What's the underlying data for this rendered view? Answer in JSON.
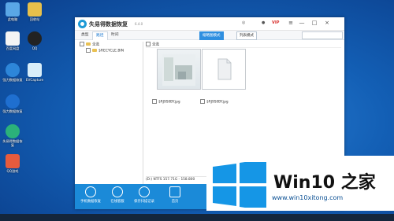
{
  "desktop_icons": [
    {
      "label": "此电脑",
      "color": "#5aa7e6"
    },
    {
      "label": "回收站",
      "color": "#e7c04b"
    },
    {
      "label": "百度网盘",
      "color": "#f4f4f4"
    },
    {
      "label": "QQ",
      "color": "#222"
    },
    {
      "label": "强力数据恢复",
      "color": "#2d86d9"
    },
    {
      "label": "EVCapture",
      "color": "#d9eef9"
    },
    {
      "label": "强力数据恢复",
      "color": "#1f6fd0"
    },
    {
      "label": "失易得数据恢复",
      "color": "#2bb17a"
    },
    {
      "label": "QQ游戏",
      "color": "#e75b3d"
    }
  ],
  "window": {
    "title": "失易得数据恢复",
    "version": "6.4.0",
    "toolbar": {
      "help": "◎",
      "vip": "VIP"
    },
    "controls": {
      "min": "—",
      "max": "□",
      "close": "×",
      "menu": "≡"
    }
  },
  "tabs": [
    "类型",
    "路径",
    "时间"
  ],
  "active_tab": 1,
  "view_buttons": [
    "缩略图模式",
    "列表模式"
  ],
  "tree": {
    "root": "全选",
    "items": [
      "$RECYCLE.BIN"
    ]
  },
  "files_header": "全选",
  "files": [
    {
      "name": "$RJ9S0BY.jpg",
      "thumb": "photo"
    },
    {
      "name": "$RJ9S0BY.jpg",
      "thumb": "doc"
    }
  ],
  "status": "(D:) NTFS 157.71G - 158.800",
  "footer_buttons": [
    "手机数据恢复",
    "在线客服",
    "保存扫描记录",
    "首页"
  ],
  "watermark": {
    "brand": "Win10 之家",
    "url": "www.win10xitong.com"
  }
}
